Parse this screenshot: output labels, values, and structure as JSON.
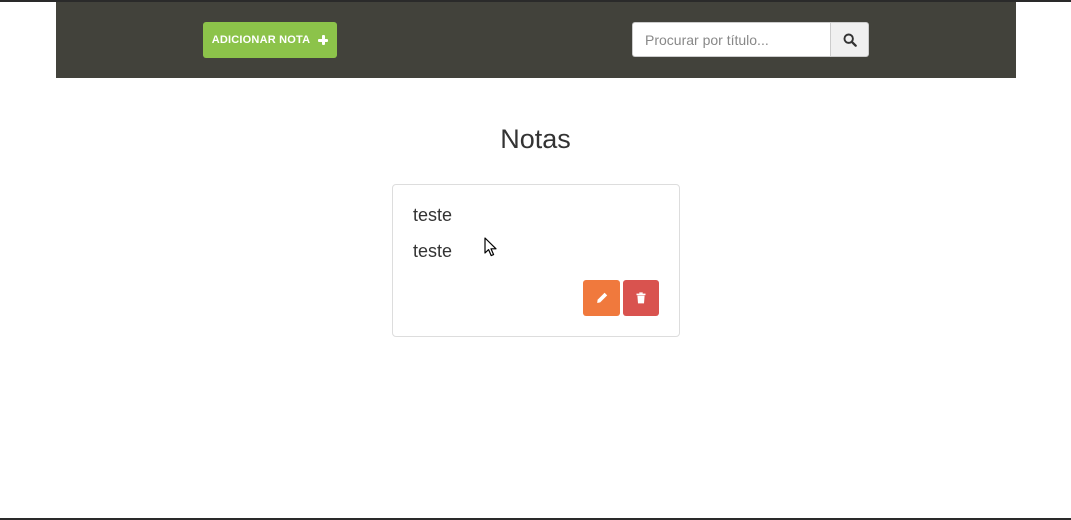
{
  "navbar": {
    "add_button_label": "ADICIONAR NOTA",
    "search": {
      "placeholder": "Procurar por título...",
      "value": ""
    }
  },
  "main": {
    "title": "Notas",
    "notes": [
      {
        "title": "teste",
        "body": "teste"
      }
    ]
  },
  "colors": {
    "navbar_bg": "#42423b",
    "add_button": "#8cc34a",
    "edit_button": "#f0793d",
    "delete_button": "#d9534f"
  },
  "icons": {
    "add": "plus-icon",
    "search": "search-icon",
    "edit": "pencil-icon",
    "delete": "trash-icon"
  }
}
